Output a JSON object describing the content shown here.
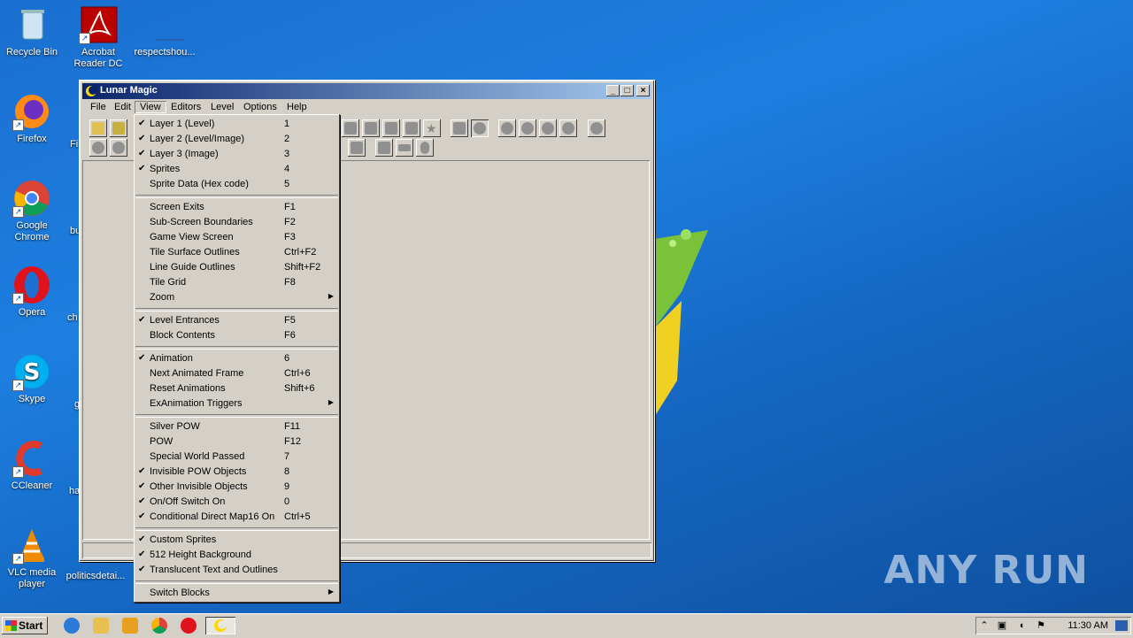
{
  "desktop": {
    "icons": [
      {
        "label": "Recycle Bin"
      },
      {
        "label": "Acrobat Reader DC"
      },
      {
        "label": "respectshou..."
      },
      {
        "label": "Firefox"
      },
      {
        "label": "Google Chrome"
      },
      {
        "label": "Opera"
      },
      {
        "label": "Skype"
      },
      {
        "label": "CCleaner"
      },
      {
        "label": "VLC media player"
      },
      {
        "label": "politicsdetai..."
      }
    ],
    "partial_labels": [
      "Fi",
      "bu",
      "ch",
      "g",
      "ha"
    ],
    "watermark": "ANY RUN"
  },
  "window": {
    "title": "Lunar Magic",
    "menubar": [
      "File",
      "Edit",
      "View",
      "Editors",
      "Level",
      "Options",
      "Help"
    ],
    "open_menu": "View"
  },
  "view_menu": {
    "items": [
      {
        "label": "Layer 1 (Level)",
        "shortcut": "1",
        "checked": true
      },
      {
        "label": "Layer 2 (Level/Image)",
        "shortcut": "2",
        "checked": true
      },
      {
        "label": "Layer 3 (Image)",
        "shortcut": "3",
        "checked": true
      },
      {
        "label": "Sprites",
        "shortcut": "4",
        "checked": true
      },
      {
        "label": "Sprite Data (Hex code)",
        "shortcut": "5",
        "checked": false
      },
      {
        "label": "Screen Exits",
        "shortcut": "F1",
        "checked": false
      },
      {
        "label": "Sub-Screen Boundaries",
        "shortcut": "F2",
        "checked": false
      },
      {
        "label": "Game View Screen",
        "shortcut": "F3",
        "checked": false
      },
      {
        "label": "Tile Surface Outlines",
        "shortcut": "Ctrl+F2",
        "checked": false
      },
      {
        "label": "Line Guide Outlines",
        "shortcut": "Shift+F2",
        "checked": false
      },
      {
        "label": "Tile Grid",
        "shortcut": "F8",
        "checked": false
      },
      {
        "label": "Zoom",
        "shortcut": "",
        "checked": false,
        "submenu": true
      },
      {
        "label": "Level Entrances",
        "shortcut": "F5",
        "checked": true
      },
      {
        "label": "Block Contents",
        "shortcut": "F6",
        "checked": false
      },
      {
        "label": "Animation",
        "shortcut": "6",
        "checked": true
      },
      {
        "label": "Next Animated Frame",
        "shortcut": "Ctrl+6",
        "checked": false
      },
      {
        "label": "Reset Animations",
        "shortcut": "Shift+6",
        "checked": false
      },
      {
        "label": "ExAnimation Triggers",
        "shortcut": "",
        "checked": false,
        "submenu": true
      },
      {
        "label": "Silver POW",
        "shortcut": "F11",
        "checked": false
      },
      {
        "label": "POW",
        "shortcut": "F12",
        "checked": false
      },
      {
        "label": "Special World Passed",
        "shortcut": "7",
        "checked": false
      },
      {
        "label": "Invisible POW Objects",
        "shortcut": "8",
        "checked": true
      },
      {
        "label": "Other Invisible Objects",
        "shortcut": "9",
        "checked": true
      },
      {
        "label": "On/Off Switch On",
        "shortcut": "0",
        "checked": true
      },
      {
        "label": "Conditional Direct Map16 On",
        "shortcut": "Ctrl+5",
        "checked": true
      },
      {
        "label": "Custom Sprites",
        "shortcut": "",
        "checked": true
      },
      {
        "label": "512 Height Background",
        "shortcut": "",
        "checked": true
      },
      {
        "label": "Translucent Text and Outlines",
        "shortcut": "",
        "checked": true
      },
      {
        "label": "Switch Blocks",
        "shortcut": "",
        "checked": false,
        "submenu": true
      }
    ]
  },
  "taskbar": {
    "start_label": "Start",
    "clock": "11:30 AM"
  }
}
